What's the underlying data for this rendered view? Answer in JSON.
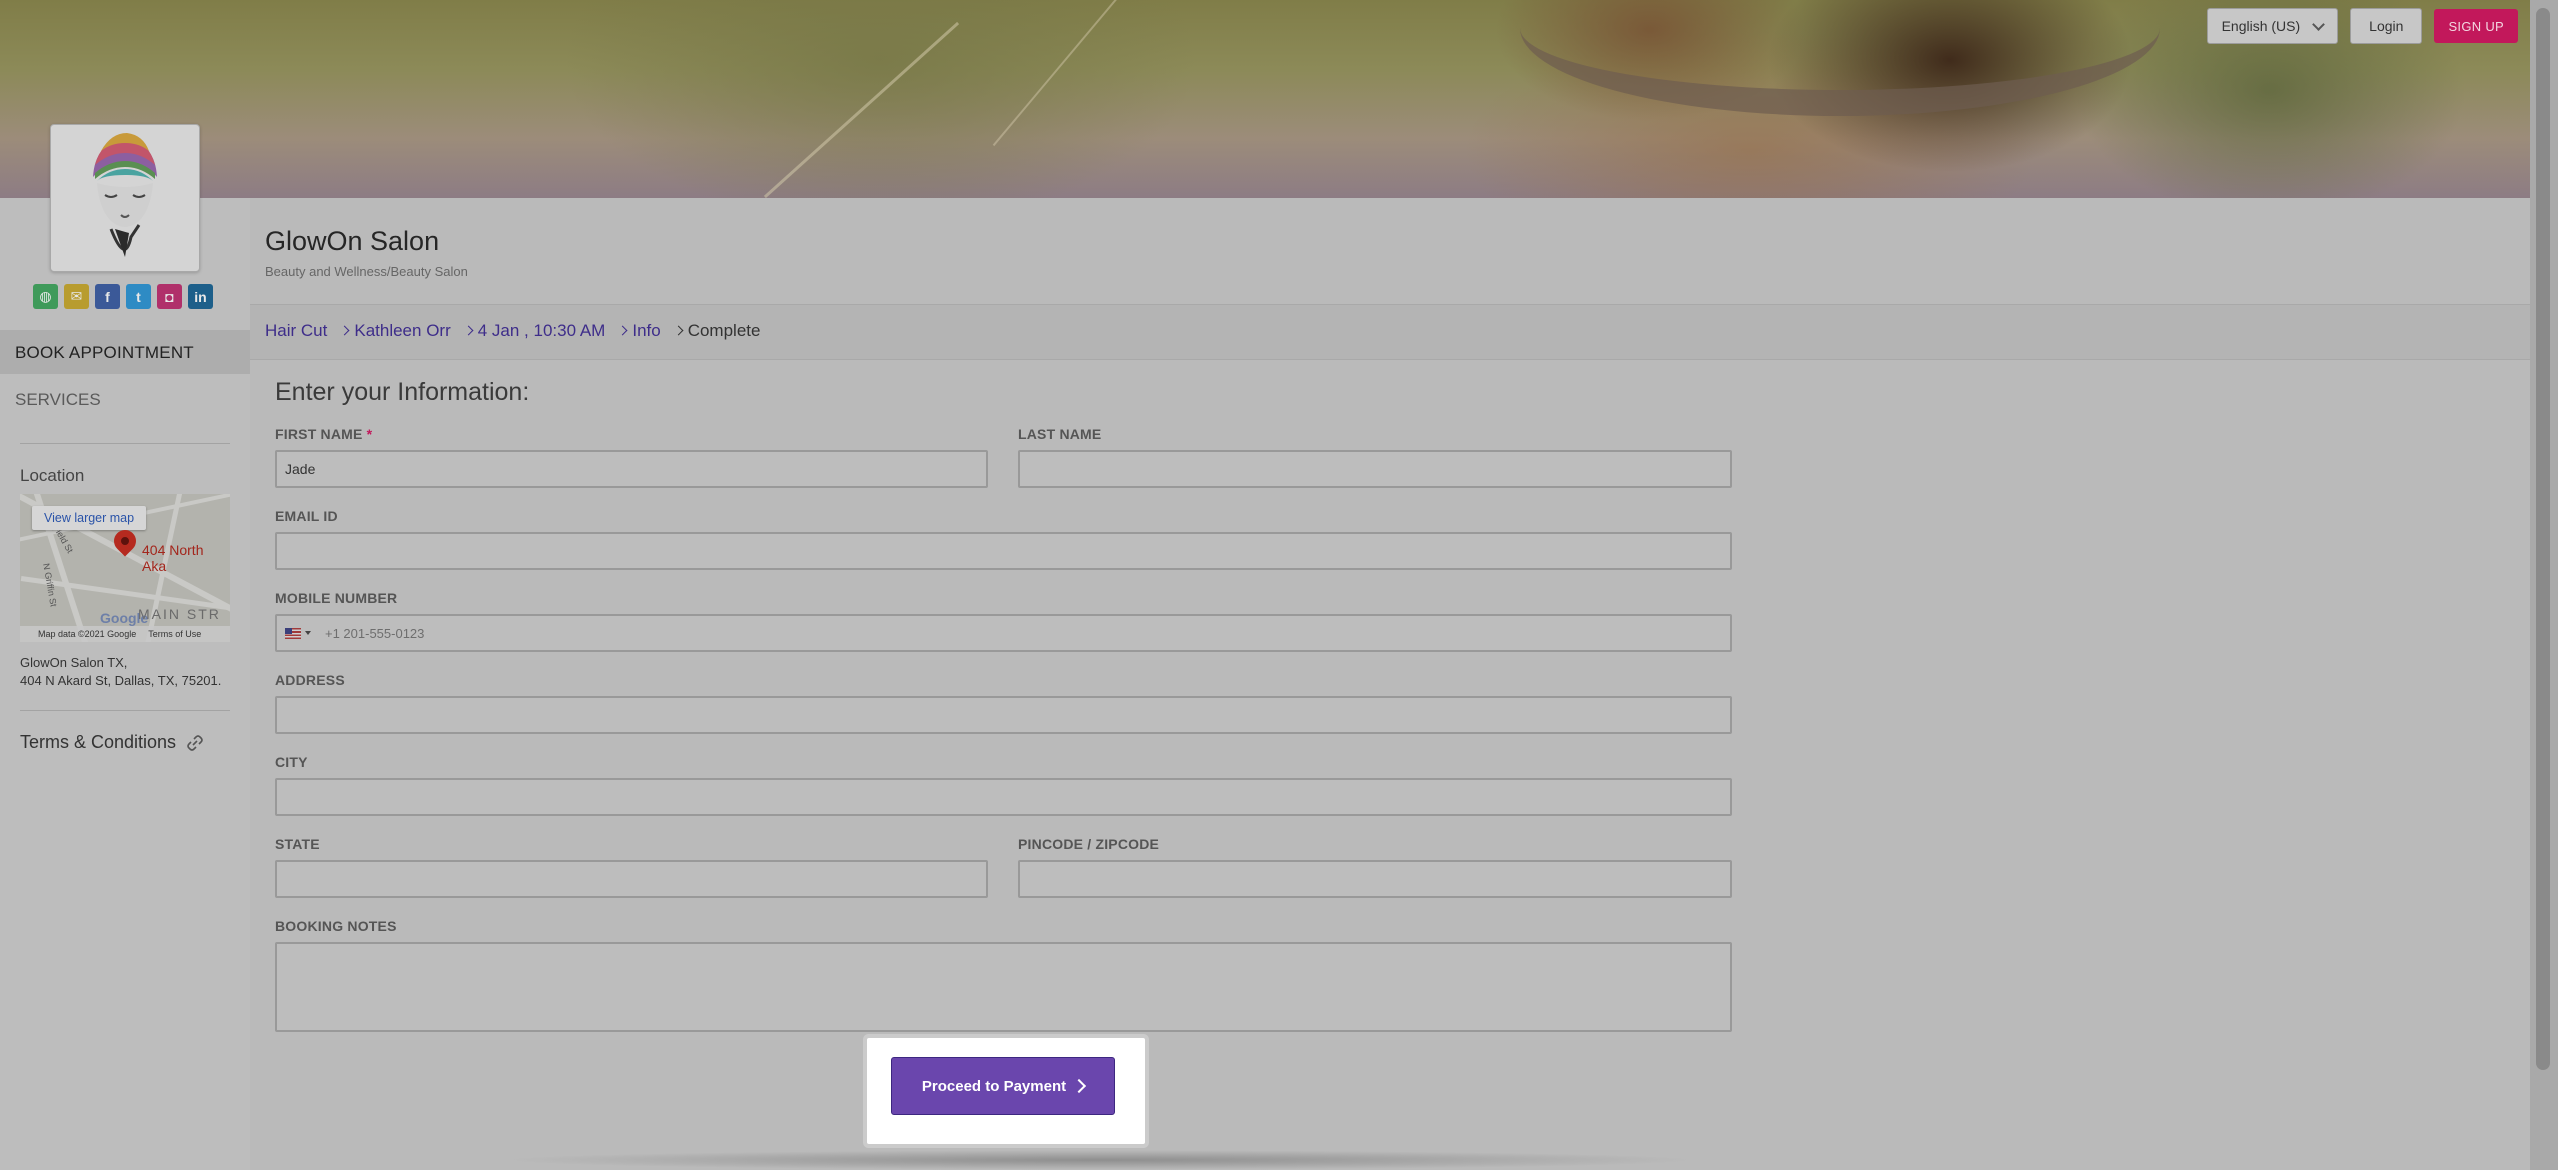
{
  "header": {
    "language": "English (US)",
    "login_label": "Login",
    "signup_label": "SIGN UP"
  },
  "salon": {
    "name": "GlowOn Salon",
    "category": "Beauty and Wellness/Beauty Salon"
  },
  "sidebar": {
    "social_icons": [
      "web-icon",
      "email-icon",
      "facebook-icon",
      "twitter-icon",
      "instagram-icon",
      "linkedin-icon"
    ],
    "nav": {
      "book_appointment": "BOOK APPOINTMENT",
      "services": "SERVICES"
    },
    "location": {
      "title": "Location",
      "map_link": "View larger map",
      "map_pin_label": "404 North Aka",
      "map_district": "MAIN STR",
      "map_google": "Google",
      "map_data": "Map data ©2021 Google",
      "map_terms": "Terms of Use",
      "address_line1": "GlowOn Salon TX,",
      "address_line2": "404 N Akard St, Dallas, TX, 75201."
    },
    "terms_label": "Terms & Conditions"
  },
  "breadcrumb": {
    "items": [
      "Hair Cut",
      "Kathleen Orr",
      "4 Jan , 10:30 AM",
      "Info",
      "Complete"
    ]
  },
  "form": {
    "title": "Enter your Information:",
    "first_name": {
      "label": "FIRST NAME",
      "required": "*",
      "value": "Jade"
    },
    "last_name": {
      "label": "LAST NAME",
      "value": ""
    },
    "email": {
      "label": "EMAIL ID",
      "value": ""
    },
    "mobile": {
      "label": "MOBILE NUMBER",
      "placeholder": "+1 201-555-0123"
    },
    "address": {
      "label": "ADDRESS",
      "value": ""
    },
    "city": {
      "label": "CITY",
      "value": ""
    },
    "state": {
      "label": "STATE",
      "value": ""
    },
    "zip": {
      "label": "PINCODE / ZIPCODE",
      "value": ""
    },
    "notes": {
      "label": "BOOKING NOTES",
      "value": ""
    },
    "submit_label": "Proceed to Payment"
  },
  "colors": {
    "accent": "#6a46ad",
    "signup": "#c2185b",
    "link": "#3e2d8a"
  }
}
